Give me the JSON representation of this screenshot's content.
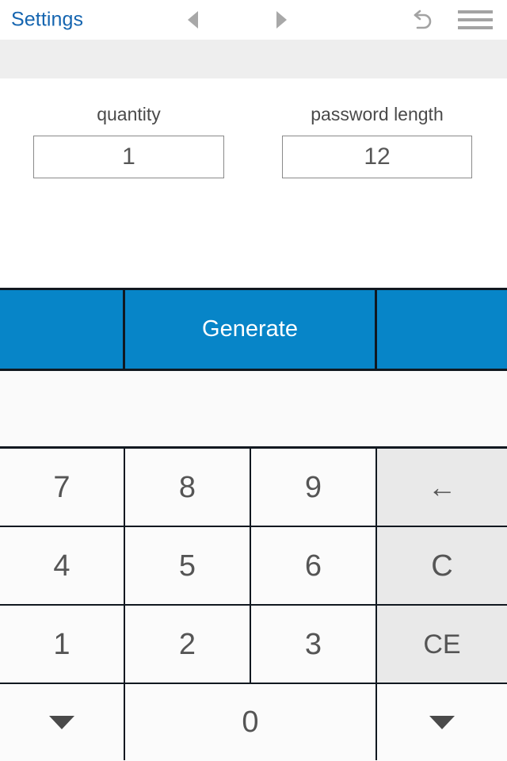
{
  "toolbar": {
    "settings_label": "Settings",
    "back_icon": "triangle-left-icon",
    "forward_icon": "triangle-right-icon",
    "undo_icon": "undo-arrow-icon",
    "menu_icon": "hamburger-menu-icon"
  },
  "form": {
    "quantity": {
      "label": "quantity",
      "value": "1"
    },
    "password_length": {
      "label": "password length",
      "value": "12"
    }
  },
  "actions": {
    "generate_label": "Generate"
  },
  "keypad": {
    "rows": [
      [
        {
          "label": "7",
          "name": "key-7",
          "style": "normal"
        },
        {
          "label": "8",
          "name": "key-8",
          "style": "normal"
        },
        {
          "label": "9",
          "name": "key-9",
          "style": "normal"
        },
        {
          "label": "←",
          "name": "key-backspace",
          "style": "gray"
        }
      ],
      [
        {
          "label": "4",
          "name": "key-4",
          "style": "normal"
        },
        {
          "label": "5",
          "name": "key-5",
          "style": "normal"
        },
        {
          "label": "6",
          "name": "key-6",
          "style": "normal"
        },
        {
          "label": "C",
          "name": "key-clear",
          "style": "gray"
        }
      ],
      [
        {
          "label": "1",
          "name": "key-1",
          "style": "normal"
        },
        {
          "label": "2",
          "name": "key-2",
          "style": "normal"
        },
        {
          "label": "3",
          "name": "key-3",
          "style": "normal"
        },
        {
          "label": "CE",
          "name": "key-clear-entry",
          "style": "gray"
        }
      ]
    ],
    "last_row": {
      "prev_field_icon": "triangle-down-icon",
      "zero_label": "0",
      "next_field_icon": "triangle-down-icon"
    }
  },
  "colors": {
    "accent_blue": "#0785c8",
    "link_blue": "#1565b0",
    "key_gray": "#e9e9e9",
    "band_gray": "#eeeeee",
    "divider_dark": "#111820"
  }
}
